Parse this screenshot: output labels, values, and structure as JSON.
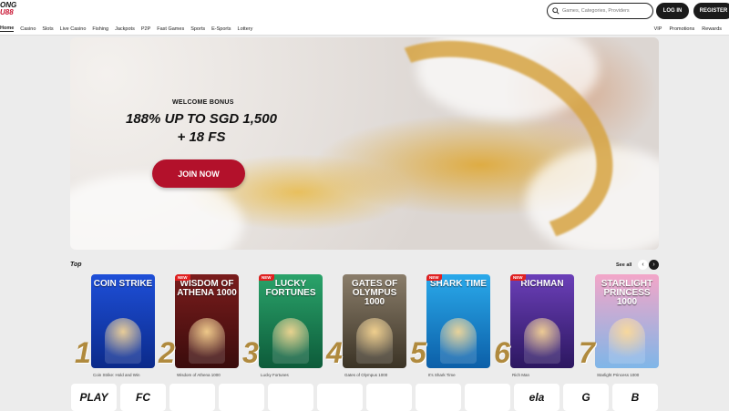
{
  "header": {
    "logo_line1": "ONG",
    "logo_line2": "U88",
    "search_placeholder": "Games, Categories, Providers",
    "login_label": "LOG IN",
    "register_label": "REGISTER"
  },
  "nav": {
    "left": [
      "Home",
      "Casino",
      "Slots",
      "Live Casino",
      "Fishing",
      "Jackpots",
      "P2P",
      "Fast Games",
      "Sports",
      "E-Sports",
      "Lottery"
    ],
    "right": [
      "VIP",
      "Promotions",
      "Rewards"
    ]
  },
  "banner": {
    "welcome": "WELCOME BONUS",
    "headline_line1": "188% UP TO SGD 1,500",
    "headline_line2": "+ 18 FS",
    "cta": "JOIN NOW"
  },
  "top": {
    "title": "Top",
    "see_all": "See all",
    "prev_icon": "chevron-left-icon",
    "next_icon": "chevron-right-icon",
    "games": [
      {
        "rank": "1",
        "title": "COIN STRIKE",
        "caption": "Coin Strike: Hold and Win",
        "new": false,
        "color1": "#1e4fd8",
        "color2": "#0b2a8a"
      },
      {
        "rank": "2",
        "title": "WISDOM OF ATHENA 1000",
        "caption": "Wisdom of Athena 1000",
        "new": true,
        "new_label": "NEW",
        "color1": "#7a1c1c",
        "color2": "#3a0c0c"
      },
      {
        "rank": "3",
        "title": "LUCKY FORTUNES",
        "caption": "Lucky Fortunes",
        "new": true,
        "new_label": "NEW",
        "color1": "#2aa36a",
        "color2": "#0d5b3a"
      },
      {
        "rank": "4",
        "title": "GATES OF OLYMPUS 1000",
        "caption": "Gates of Olympus 1000",
        "new": false,
        "color1": "#8a7d6a",
        "color2": "#3b3325"
      },
      {
        "rank": "5",
        "title": "SHARK TIME",
        "caption": "It's Shark Time",
        "new": true,
        "new_label": "NEW",
        "color1": "#2aa9ea",
        "color2": "#0c5fa8"
      },
      {
        "rank": "6",
        "title": "RICHMAN",
        "caption": "Rich Man",
        "new": true,
        "new_label": "NEW",
        "color1": "#6b3fb8",
        "color2": "#2c1760"
      },
      {
        "rank": "7",
        "title": "STARLIGHT PRINCESS 1000",
        "caption": "Starlight Princess 1000",
        "new": false,
        "color1": "#f3a6c8",
        "color2": "#7fb6e8"
      }
    ]
  },
  "providers": [
    "PLAY",
    "FC",
    "",
    "",
    "",
    "",
    "",
    "",
    "",
    "ela",
    "G",
    "B"
  ]
}
